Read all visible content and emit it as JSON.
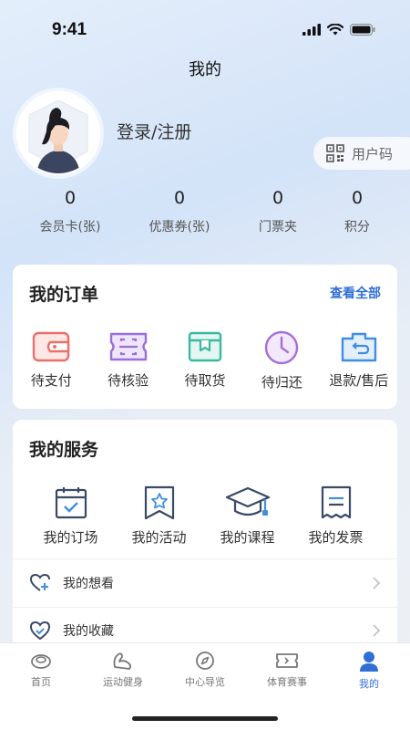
{
  "status_bar": {
    "time": "9:41"
  },
  "header": {
    "title": "我的"
  },
  "profile": {
    "login_label": "登录/注册",
    "user_code_label": "用户码"
  },
  "stats": [
    {
      "value": "0",
      "label": "会员卡(张)"
    },
    {
      "value": "0",
      "label": "优惠券(张)"
    },
    {
      "value": "0",
      "label": "门票夹"
    },
    {
      "value": "0",
      "label": "积分"
    }
  ],
  "orders": {
    "title": "我的订单",
    "view_all": "查看全部",
    "items": [
      {
        "label": "待支付",
        "icon": "wallet-icon",
        "color": "#e8716a"
      },
      {
        "label": "待核验",
        "icon": "ticket-scan-icon",
        "color": "#9b6fd8"
      },
      {
        "label": "待取货",
        "icon": "package-icon",
        "color": "#3cb8a0"
      },
      {
        "label": "待归还",
        "icon": "clock-icon",
        "color": "#a66fd8"
      },
      {
        "label": "退款/售后",
        "icon": "refund-icon",
        "color": "#3f8ee0"
      }
    ]
  },
  "services": {
    "title": "我的服务",
    "items": [
      {
        "label": "我的订场",
        "icon": "calendar-check-icon"
      },
      {
        "label": "我的活动",
        "icon": "star-bookmark-icon"
      },
      {
        "label": "我的课程",
        "icon": "graduation-cap-icon"
      },
      {
        "label": "我的发票",
        "icon": "receipt-icon"
      }
    ],
    "list": [
      {
        "label": "我的想看",
        "icon": "heart-plus-icon"
      },
      {
        "label": "我的收藏",
        "icon": "heart-check-icon"
      }
    ]
  },
  "tab_bar": {
    "tabs": [
      {
        "label": "首页",
        "icon": "home-icon"
      },
      {
        "label": "运动健身",
        "icon": "fitness-icon"
      },
      {
        "label": "中心导览",
        "icon": "compass-icon"
      },
      {
        "label": "体育赛事",
        "icon": "event-ticket-icon"
      },
      {
        "label": "我的",
        "icon": "user-icon",
        "active": true
      }
    ]
  },
  "colors": {
    "accent": "#2f6fd6",
    "icon_dark": "#3a4a66"
  }
}
